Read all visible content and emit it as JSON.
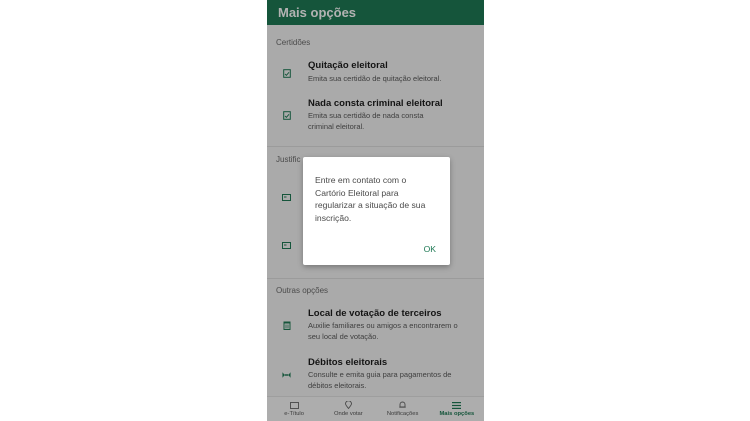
{
  "appbar": {
    "title": "Mais opções"
  },
  "sections": {
    "certidoes": "Certidões",
    "justificativas": "Justific",
    "outras": "Outras opções"
  },
  "items": {
    "quitacao": {
      "title": "Quitação eleitoral",
      "desc": "Emita sua certidão de quitação eleitoral.",
      "icon": "document-check-icon"
    },
    "nada_consta": {
      "title": "Nada consta criminal eleitoral",
      "desc": "Emita sua certidão de nada consta criminal eleitoral.",
      "icon": "document-check-icon"
    },
    "terceiros": {
      "title": "Local de votação de terceiros",
      "desc": "Auxilie familiares ou amigos a encontrarem o seu local de votação.",
      "icon": "building-icon"
    },
    "debitos": {
      "title": "Débitos eleitorais",
      "desc": "Consulte e emita guia para pagamentos de débitos eleitorais.",
      "icon": "money-icon"
    }
  },
  "bottom_nav": [
    {
      "label": "e-Título",
      "icon": "id-card-icon"
    },
    {
      "label": "Onde votar",
      "icon": "location-pin-icon"
    },
    {
      "label": "Notificações",
      "icon": "bell-icon"
    },
    {
      "label": "Mais opções",
      "icon": "menu-icon"
    }
  ],
  "dialog": {
    "message": "Entre em contato com o Cartório Eleitoral para regularizar a situação de sua inscrição.",
    "ok": "OK"
  },
  "colors": {
    "primary": "#1f7a55"
  }
}
